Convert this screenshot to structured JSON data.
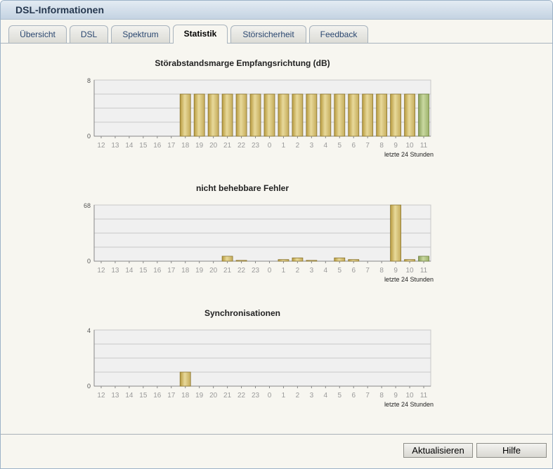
{
  "window": {
    "title": "DSL-Informationen"
  },
  "tabs": [
    {
      "label": "Übersicht",
      "active": false
    },
    {
      "label": "DSL",
      "active": false
    },
    {
      "label": "Spektrum",
      "active": false
    },
    {
      "label": "Statistik",
      "active": true
    },
    {
      "label": "Störsicherheit",
      "active": false
    },
    {
      "label": "Feedback",
      "active": false
    }
  ],
  "buttons": {
    "refresh": "Aktualisieren",
    "help": "Hilfe"
  },
  "colors": {
    "bar_fill": "#d6c278",
    "bar_current": "#a9bd78",
    "plot_bg": "#f0f0f0"
  },
  "chart_data": [
    {
      "type": "bar",
      "title": "Störabstandsmarge Empfangsrichtung (dB)",
      "categories": [
        "12",
        "13",
        "14",
        "15",
        "16",
        "17",
        "18",
        "19",
        "20",
        "21",
        "22",
        "23",
        "0",
        "1",
        "2",
        "3",
        "4",
        "5",
        "6",
        "7",
        "8",
        "9",
        "10",
        "11"
      ],
      "values": [
        0,
        0,
        0,
        0,
        0,
        0,
        6,
        6,
        6,
        6,
        6,
        6,
        6,
        6,
        6,
        6,
        6,
        6,
        6,
        6,
        6,
        6,
        6,
        6
      ],
      "ylim": [
        0,
        8
      ],
      "ymax_label": "8",
      "ymin_label": "0",
      "xlabel": "letzte 24 Stunden",
      "grid": true
    },
    {
      "type": "bar",
      "title": "nicht behebbare Fehler",
      "categories": [
        "12",
        "13",
        "14",
        "15",
        "16",
        "17",
        "18",
        "19",
        "20",
        "21",
        "22",
        "23",
        "0",
        "1",
        "2",
        "3",
        "4",
        "5",
        "6",
        "7",
        "8",
        "9",
        "10",
        "11"
      ],
      "values": [
        0,
        0,
        0,
        0,
        0,
        0,
        0,
        0,
        0,
        6,
        1,
        0,
        0,
        2,
        4,
        1,
        0,
        4,
        2,
        0,
        0,
        68,
        2,
        6
      ],
      "ylim": [
        0,
        68
      ],
      "ymax_label": "68",
      "ymin_label": "0",
      "xlabel": "letzte 24 Stunden",
      "grid": true
    },
    {
      "type": "bar",
      "title": "Synchronisationen",
      "categories": [
        "12",
        "13",
        "14",
        "15",
        "16",
        "17",
        "18",
        "19",
        "20",
        "21",
        "22",
        "23",
        "0",
        "1",
        "2",
        "3",
        "4",
        "5",
        "6",
        "7",
        "8",
        "9",
        "10",
        "11"
      ],
      "values": [
        0,
        0,
        0,
        0,
        0,
        0,
        1,
        0,
        0,
        0,
        0,
        0,
        0,
        0,
        0,
        0,
        0,
        0,
        0,
        0,
        0,
        0,
        0,
        0
      ],
      "ylim": [
        0,
        4
      ],
      "ymax_label": "4",
      "ymin_label": "0",
      "xlabel": "letzte 24 Stunden",
      "grid": true
    }
  ]
}
